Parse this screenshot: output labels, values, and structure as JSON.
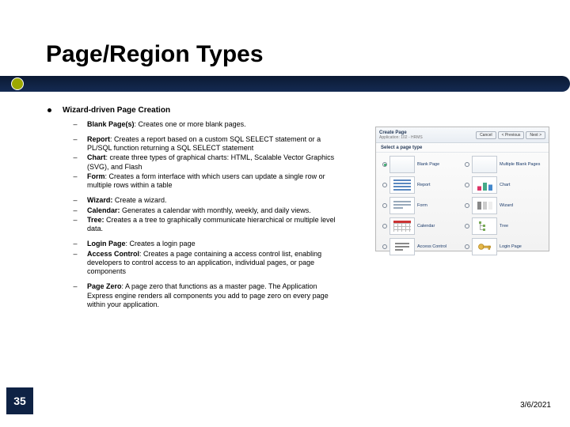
{
  "title": "Page/Region Types",
  "heading": "Wizard-driven Page Creation",
  "groups": [
    [
      {
        "lead": "Blank Page(s)",
        "sep": ": ",
        "body": "Creates one or more blank pages."
      }
    ],
    [
      {
        "lead": "Report",
        "sep": ": ",
        "body": "Creates a report based on a custom SQL SELECT statement or a PL/SQL function returning a SQL SELECT statement"
      },
      {
        "lead": "Chart",
        "sep": ": ",
        "body": "create three types of graphical charts: HTML, Scalable Vector Graphics (SVG), and Flash"
      },
      {
        "lead": "Form",
        "sep": ": ",
        "body": "Creates a form interface with which users can update a single row or multiple rows within a table"
      }
    ],
    [
      {
        "lead": "Wizard:",
        "sep": " ",
        "body": "Create a wizard."
      },
      {
        "lead": "Calendar:",
        "sep": " ",
        "body": "Generates a calendar with monthly, weekly, and daily views."
      },
      {
        "lead": "Tree:",
        "sep": " ",
        "body": "Creates a a tree to graphically communicate hierarchical or multiple level data."
      }
    ],
    [
      {
        "lead": "Login Page",
        "sep": ": ",
        "body": "Creates a login page"
      },
      {
        "lead": "Access Control",
        "sep": ": ",
        "body": "Creates a page containing a access control list, enabling developers to control access to an application, individual pages, or page components"
      }
    ],
    [
      {
        "lead": "Page Zero",
        "sep": ": ",
        "body": "A page zero that functions as a master page. The Application Express engine renders all components you add to page zero on every page within your application."
      }
    ]
  ],
  "slide_number": "35",
  "date": "3/6/2021",
  "thumb": {
    "dialog_title": "Create Page",
    "app_label": "Application: 102 - HRMS",
    "subtitle": "Select a page type",
    "buttons": {
      "cancel": "Cancel",
      "prev": "< Previous",
      "next": "Next >"
    },
    "options": [
      {
        "label": "Blank Page",
        "selected": true
      },
      {
        "label": "Multiple Blank Pages",
        "selected": false
      },
      {
        "label": "Report",
        "selected": false
      },
      {
        "label": "Chart",
        "selected": false
      },
      {
        "label": "Form",
        "selected": false
      },
      {
        "label": "Wizard",
        "selected": false
      },
      {
        "label": "Calendar",
        "selected": false
      },
      {
        "label": "Tree",
        "selected": false
      },
      {
        "label": "Access Control",
        "selected": false
      },
      {
        "label": "Login Page",
        "selected": false
      }
    ]
  }
}
